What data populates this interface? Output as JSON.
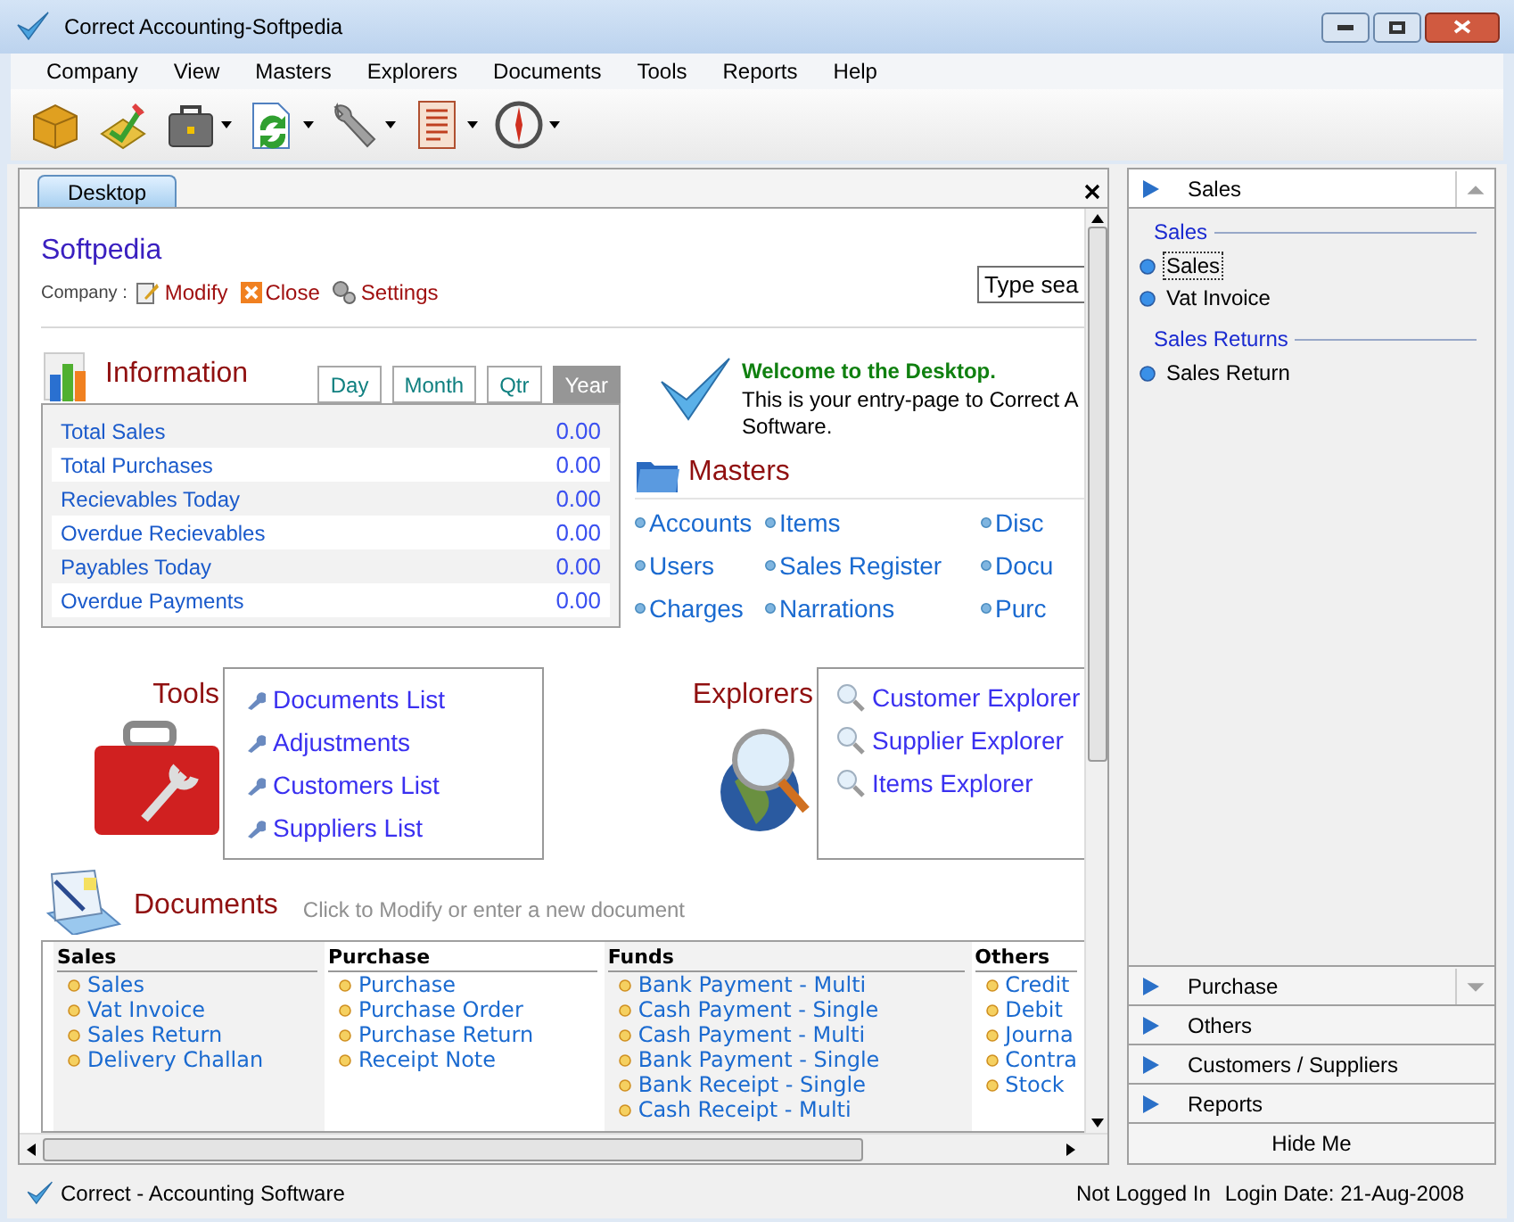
{
  "window": {
    "title": "Correct Accounting-Softpedia"
  },
  "menu": [
    "Company",
    "View",
    "Masters",
    "Explorers",
    "Documents",
    "Tools",
    "Reports",
    "Help"
  ],
  "toolbar": [
    {
      "kind": "package",
      "dropdown": false
    },
    {
      "kind": "approve",
      "dropdown": false
    },
    {
      "kind": "briefcase",
      "dropdown": true
    },
    {
      "kind": "sync",
      "dropdown": true
    },
    {
      "kind": "wrench",
      "dropdown": true
    },
    {
      "kind": "report",
      "dropdown": true
    },
    {
      "kind": "compass",
      "dropdown": true
    }
  ],
  "document_tabs": [
    {
      "label": "Desktop",
      "selected": true
    }
  ],
  "company": {
    "name": "Softpedia",
    "label": "Company :",
    "actions": [
      {
        "kind": "modify",
        "label": "Modify"
      },
      {
        "kind": "close",
        "label": "Close"
      },
      {
        "kind": "settings",
        "label": "Settings"
      }
    ],
    "search_value": "Type sea"
  },
  "information": {
    "title": "Information",
    "periods": [
      {
        "label": "Day",
        "selected": false
      },
      {
        "label": "Month",
        "selected": false
      },
      {
        "label": "Qtr",
        "selected": false
      },
      {
        "label": "Year",
        "selected": true
      }
    ],
    "rows": [
      {
        "label": "Total Sales",
        "value": "0.00"
      },
      {
        "label": "Total Purchases",
        "value": "0.00"
      },
      {
        "label": "Recievables Today",
        "value": "0.00"
      },
      {
        "label": "Overdue Recievables",
        "value": "0.00"
      },
      {
        "label": "Payables Today",
        "value": "0.00"
      },
      {
        "label": "Overdue Payments",
        "value": "0.00"
      }
    ]
  },
  "welcome": {
    "title": "Welcome to the Desktop.",
    "text": "This is your entry-page to Correct A Software."
  },
  "masters": {
    "title": "Masters",
    "links": [
      "Accounts",
      "Items",
      "Disc",
      "Users",
      "Sales Register",
      "Docu",
      "Charges",
      "Narrations",
      "Purc"
    ]
  },
  "tools": {
    "title": "Tools",
    "links": [
      "Documents List",
      "Adjustments",
      "Customers List",
      "Suppliers List"
    ]
  },
  "explorers": {
    "title": "Explorers",
    "links": [
      "Customer Explorer",
      "Supplier Explorer",
      "Items Explorer"
    ]
  },
  "documents": {
    "title": "Documents",
    "hint": "Click to Modify or enter a new document",
    "columns": [
      {
        "heading": "Sales",
        "items": [
          "Sales",
          "Vat Invoice",
          "Sales Return",
          "Delivery Challan"
        ]
      },
      {
        "heading": "Purchase",
        "items": [
          "Purchase",
          "Purchase Order",
          "Purchase Return",
          "Receipt Note"
        ]
      },
      {
        "heading": "Funds",
        "items": [
          "Bank Payment - Multi",
          "Cash Payment - Single",
          "Cash Payment - Multi",
          "Bank Payment - Single",
          "Bank Receipt - Single",
          "Cash Receipt - Multi"
        ]
      },
      {
        "heading": "Others",
        "items": [
          "Credit",
          "Debit",
          "Journa",
          "Contra",
          "Stock"
        ]
      }
    ]
  },
  "side_panel": {
    "sections": [
      {
        "label": "Sales",
        "expanded": true,
        "groups": [
          {
            "heading": "Sales",
            "items": [
              {
                "label": "Sales",
                "selected": true
              },
              {
                "label": "Vat Invoice",
                "selected": false
              }
            ]
          },
          {
            "heading": "Sales Returns",
            "items": [
              {
                "label": "Sales Return",
                "selected": false
              }
            ]
          }
        ]
      },
      {
        "label": "Purchase",
        "expanded": false
      },
      {
        "label": "Others",
        "expanded": false
      },
      {
        "label": "Customers / Suppliers",
        "expanded": false
      },
      {
        "label": "Reports",
        "expanded": false
      }
    ],
    "hide_button": "Hide Me"
  },
  "status_bar": {
    "app": "Correct - Accounting Software",
    "login": "Not Logged In",
    "date": "Login Date: 21-Aug-2008"
  }
}
